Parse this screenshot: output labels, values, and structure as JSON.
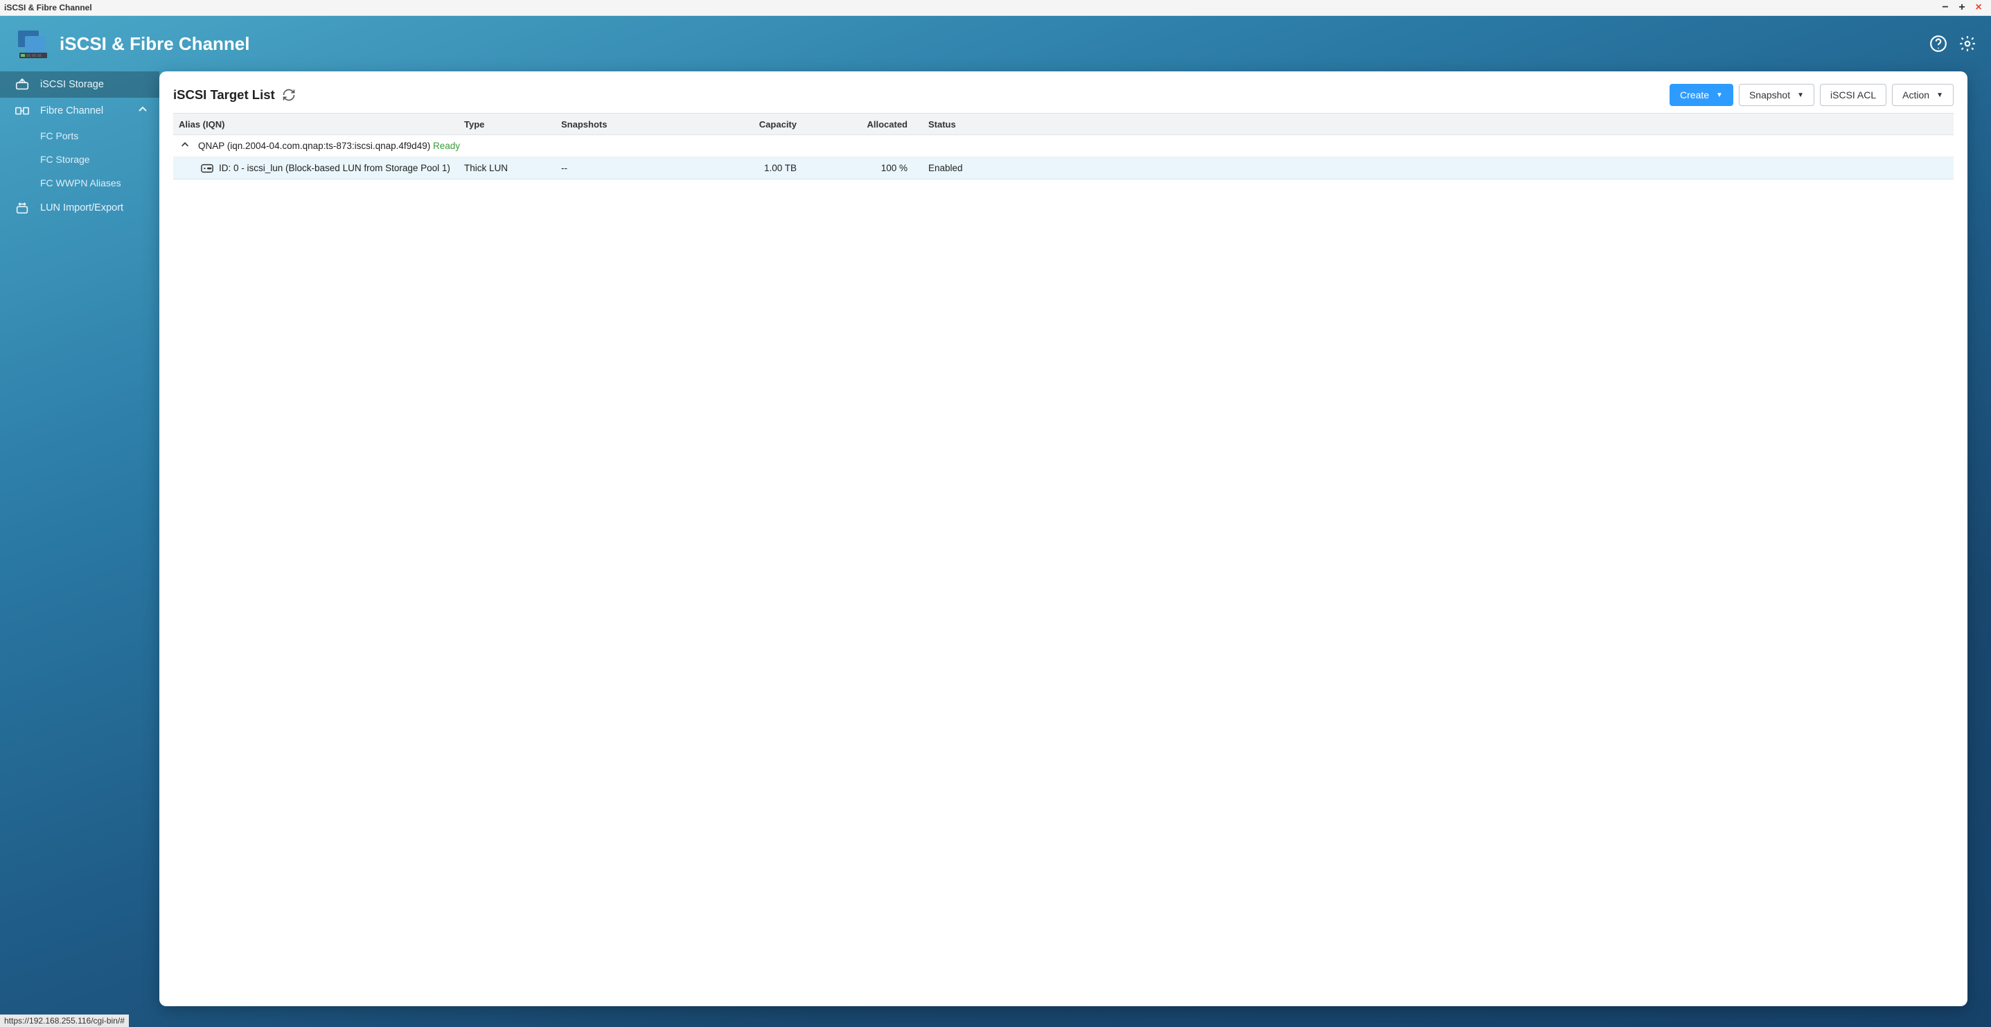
{
  "window": {
    "title": "iSCSI & Fibre Channel"
  },
  "header": {
    "app_title": "iSCSI & Fibre Channel"
  },
  "sidebar": {
    "items": [
      {
        "label": "iSCSI Storage"
      },
      {
        "label": "Fibre Channel"
      },
      {
        "label": "LUN Import/Export"
      }
    ],
    "fc_children": [
      {
        "label": "FC Ports"
      },
      {
        "label": "FC Storage"
      },
      {
        "label": "FC WWPN Aliases"
      }
    ]
  },
  "panel": {
    "title": "iSCSI Target List",
    "buttons": {
      "create": "Create",
      "snapshot": "Snapshot",
      "acl": "iSCSI ACL",
      "action": "Action"
    }
  },
  "table": {
    "headers": {
      "alias": "Alias (IQN)",
      "type": "Type",
      "snapshots": "Snapshots",
      "capacity": "Capacity",
      "allocated": "Allocated",
      "status": "Status"
    },
    "target": {
      "alias_prefix": "QNAP ",
      "iqn": "(iqn.2004-04.com.qnap:ts-873:iscsi.qnap.4f9d49)",
      "state": " Ready"
    },
    "lun": {
      "name": "ID: 0 - iscsi_lun (Block-based LUN from Storage Pool 1)",
      "type": "Thick LUN",
      "snapshots": "--",
      "capacity": "1.00 TB",
      "allocated": "100 %",
      "status": "Enabled"
    }
  },
  "statusbar": {
    "text": "https://192.168.255.116/cgi-bin/#"
  }
}
